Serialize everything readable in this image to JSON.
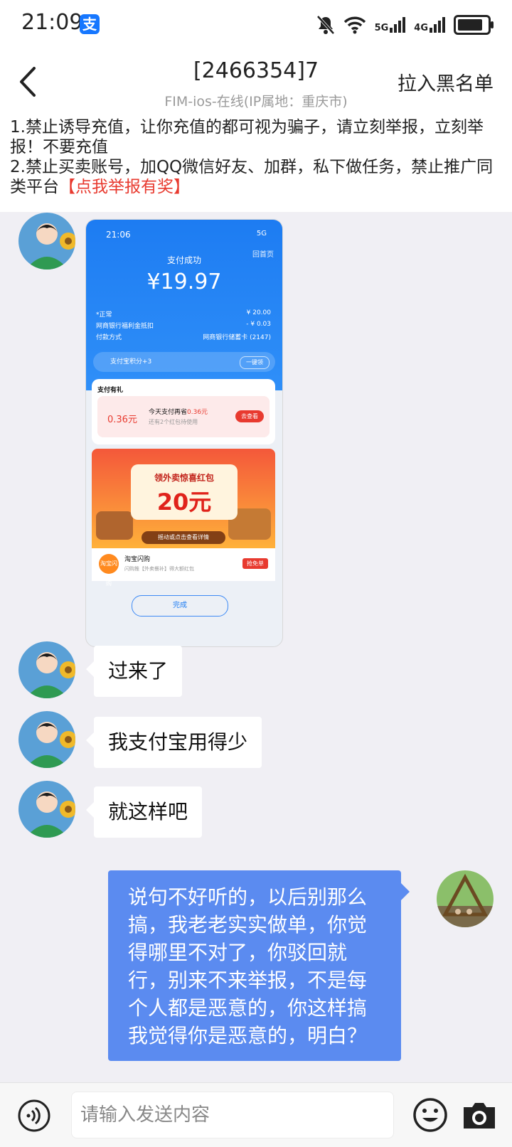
{
  "status_bar": {
    "time": "21:09",
    "net1": "5G",
    "net2": "4G"
  },
  "header": {
    "title": "[2466354]7",
    "subtitle": "FIM-ios-在线(IP属地：重庆市)",
    "right_action": "拉入黑名单"
  },
  "notice": {
    "line1": "1.禁止诱导充值，让你充值的都可视为骗子，请立刻举报，立刻举报！不要充值",
    "line2": "2.禁止买卖账号，加QQ微信好友、加群，私下做任务，禁止推广同类平台",
    "report_link": "【点我举报有奖】"
  },
  "screenshot_image": {
    "time": "21:06",
    "net": "5G",
    "success_text": "支付成功",
    "back_home": "回首页",
    "amount": "¥19.97",
    "rows": [
      {
        "label": "*正常",
        "value": "¥ 20.00"
      },
      {
        "label": "网商银行福利金抵扣",
        "value": "- ¥ 0.03"
      },
      {
        "label": "付款方式",
        "value": "网商银行储蓄卡 (2147)"
      }
    ],
    "points": "支付宝积分+3",
    "points_btn": "一键领",
    "gift_header": "支付有礼",
    "gift_money": "0.36元",
    "gift_line1_prefix": "今天支付再省",
    "gift_line1_amount": "0.36元",
    "gift_line2": "还有2个红包待使用",
    "gift_btn": "去查看",
    "promo_line1": "领外卖惊喜红包",
    "promo_line2": "20元",
    "promo_bar": "摇动或点击查看详情",
    "shop_name": "淘宝闪购",
    "shop_desc": "闪购推【外卖餐补】得大额红包",
    "shop_logo": "淘宝闪购",
    "shop_btn": "抢免单",
    "done": "完成"
  },
  "messages": [
    {
      "text": "过来了"
    },
    {
      "text": "我支付宝用得少"
    },
    {
      "text": "就这样吧"
    },
    {
      "text": "说句不好听的，以后别那么搞，我老老实实做单，你觉得哪里不对了，你驳回就行，别来不来举报，不是每个人都是恶意的，你这样搞我觉得你是恶意的，明白？"
    }
  ],
  "input": {
    "placeholder": "请输入发送内容"
  },
  "colors": {
    "accent": "#5b8bf0",
    "alipay_blue": "#1677ff",
    "warn_red": "#e83a2f",
    "background": "#f0eff4"
  },
  "icons": [
    "alipay-icon",
    "mute-bell-icon",
    "wifi-icon",
    "signal-icon",
    "battery-icon",
    "back-arrow-icon",
    "voice-icon",
    "emoji-icon",
    "camera-icon"
  ]
}
